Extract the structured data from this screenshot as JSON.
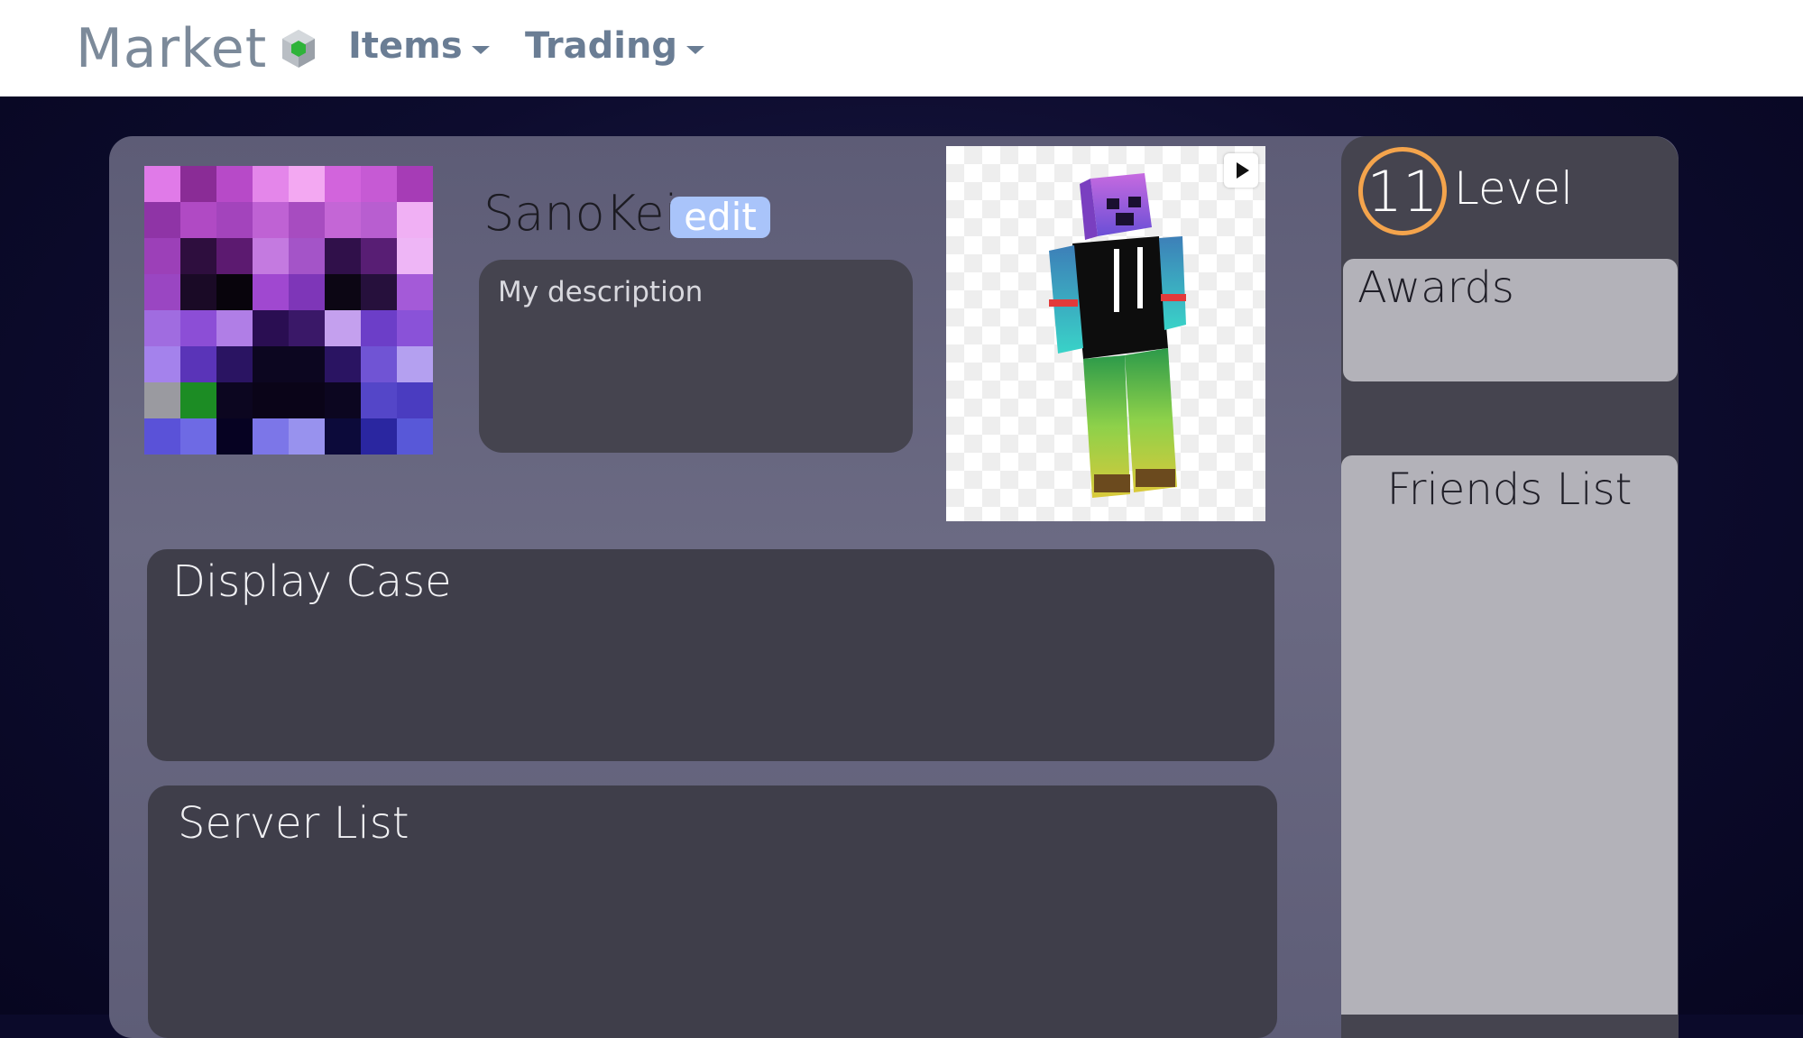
{
  "nav": {
    "brand": "Market",
    "items_label": "Items",
    "trading_label": "Trading"
  },
  "profile": {
    "username": "SanoKei",
    "edit_label": "edit",
    "description": "My description"
  },
  "sections": {
    "display_case": "Display Case",
    "server_list": "Server List"
  },
  "sidebar": {
    "level_value": "11",
    "level_label": "Level",
    "awards_title": "Awards",
    "friends_title": "Friends List"
  },
  "colors": {
    "background": "#0b0a2a",
    "panel": "#65647d",
    "box_dark": "#3f3e4a",
    "box_light": "#b3b2b9",
    "edit_button": "#a9c4fa",
    "level_ring": "#f4a44c",
    "brand_icon_green": "#2fb33a"
  },
  "icons": {
    "brand": "hexagon-cube-icon",
    "dropdown": "caret-down-icon",
    "play": "play-icon"
  }
}
